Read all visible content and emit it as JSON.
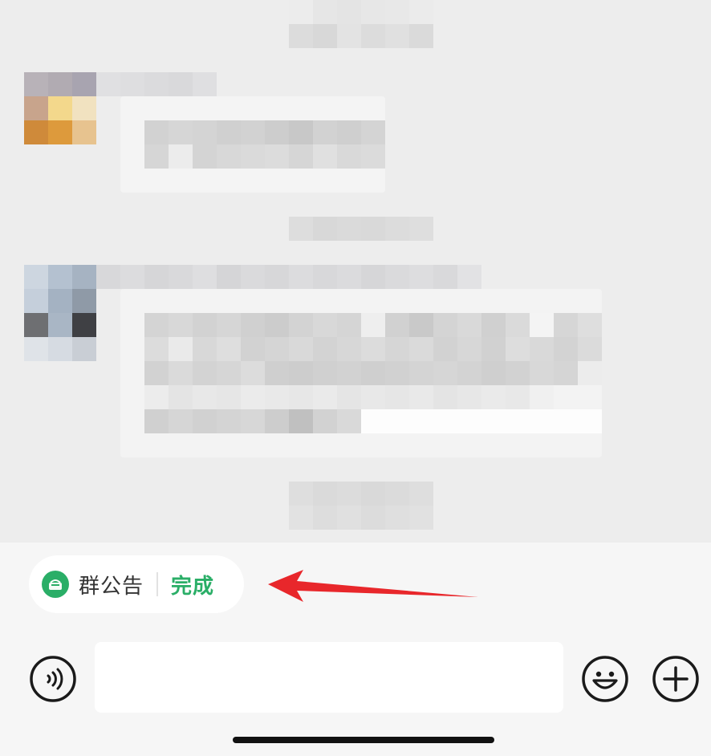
{
  "announcement": {
    "label": "群公告",
    "done_label": "完成"
  },
  "composer": {
    "placeholder": ""
  },
  "icons": {
    "voice": "voice-icon",
    "emoji": "emoji-icon",
    "plus": "plus-icon",
    "announcement": "announcement-icon"
  },
  "colors": {
    "accent": "#2aae67",
    "annotation_arrow": "#e8272b"
  }
}
